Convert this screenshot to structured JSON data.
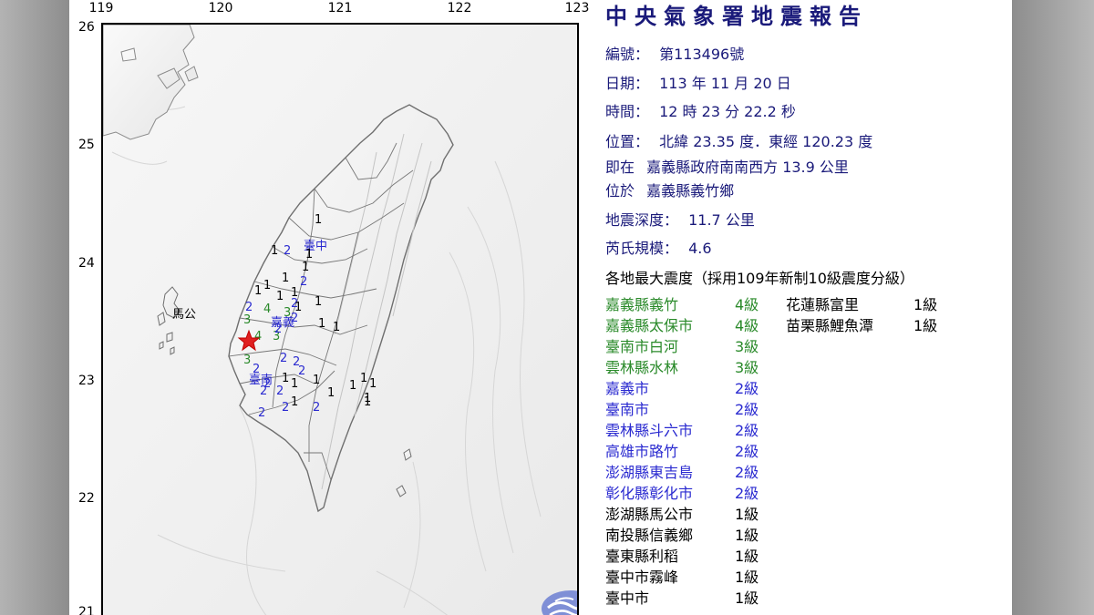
{
  "report": {
    "title": "中央氣象署地震報告",
    "number_label": "編號：",
    "number_value": "第113496號",
    "date_label": "日期：",
    "date_value": "113 年 11 月 20 日",
    "time_label": "時間：",
    "time_value": "12 時 23 分 22.2 秒",
    "location_label": "位置：",
    "location_value": "北緯 23.35 度．東經 120.23 度",
    "near_label": "即在",
    "near_value": "嘉義縣政府南南西方 13.9 公里",
    "region_label": "位於",
    "region_value": "嘉義縣義竹鄉",
    "depth_label": "地震深度：",
    "depth_value": "11.7 公里",
    "magnitude_label": "芮氏規模：",
    "magnitude_value": "4.6",
    "intensity_heading": "各地最大震度（採用109年新制10級震度分級）"
  },
  "intensity_left": [
    {
      "place": "嘉義縣義竹",
      "level": "4級",
      "color": "#2a8a2a"
    },
    {
      "place": "嘉義縣太保市",
      "level": "4級",
      "color": "#2a8a2a"
    },
    {
      "place": "臺南市白河",
      "level": "3級",
      "color": "#2a8a2a"
    },
    {
      "place": "雲林縣水林",
      "level": "3級",
      "color": "#2a8a2a"
    },
    {
      "place": "嘉義市",
      "level": "2級",
      "color": "#2a2ad0"
    },
    {
      "place": "臺南市",
      "level": "2級",
      "color": "#2a2ad0"
    },
    {
      "place": "雲林縣斗六市",
      "level": "2級",
      "color": "#2a2ad0"
    },
    {
      "place": "高雄市路竹",
      "level": "2級",
      "color": "#2a2ad0"
    },
    {
      "place": "澎湖縣東吉島",
      "level": "2級",
      "color": "#2a2ad0"
    },
    {
      "place": "彰化縣彰化市",
      "level": "2級",
      "color": "#2a2ad0"
    },
    {
      "place": "澎湖縣馬公市",
      "level": "1級",
      "color": "#000000"
    },
    {
      "place": "南投縣信義鄉",
      "level": "1級",
      "color": "#000000"
    },
    {
      "place": "臺東縣利稻",
      "level": "1級",
      "color": "#000000"
    },
    {
      "place": "臺中市霧峰",
      "level": "1級",
      "color": "#000000"
    },
    {
      "place": "臺中市",
      "level": "1級",
      "color": "#000000"
    }
  ],
  "intensity_right": [
    {
      "place": "花蓮縣富里",
      "level": "1級",
      "color": "#000000"
    },
    {
      "place": "苗栗縣鯉魚潭",
      "level": "1級",
      "color": "#000000"
    }
  ],
  "map": {
    "lon_ticks": [
      "119",
      "120",
      "121",
      "122",
      "123"
    ],
    "lat_ticks": [
      "26",
      "25",
      "24",
      "23",
      "22",
      "21"
    ],
    "city_labels": [
      {
        "text": "臺中",
        "id": "taichung"
      },
      {
        "text": "嘉義",
        "id": "chiayi"
      },
      {
        "text": "臺南",
        "id": "tainan"
      },
      {
        "text": "馬公",
        "id": "magong"
      }
    ],
    "station_marks": [
      {
        "v": "1",
        "c": "#000000"
      },
      {
        "v": "1",
        "c": "#000000"
      },
      {
        "v": "2",
        "c": "#2a2ad0"
      },
      {
        "v": "1",
        "c": "#000000"
      },
      {
        "v": "1",
        "c": "#000000"
      },
      {
        "v": "1",
        "c": "#000000"
      },
      {
        "v": "1",
        "c": "#000000"
      },
      {
        "v": "1",
        "c": "#000000"
      },
      {
        "v": "1",
        "c": "#000000"
      },
      {
        "v": "1",
        "c": "#000000"
      },
      {
        "v": "2",
        "c": "#2a2ad0"
      },
      {
        "v": "2",
        "c": "#2a2ad0"
      },
      {
        "v": "1",
        "c": "#000000"
      },
      {
        "v": "1",
        "c": "#000000"
      },
      {
        "v": "3",
        "c": "#2a8a2a"
      },
      {
        "v": "2",
        "c": "#2a2ad0"
      },
      {
        "v": "4",
        "c": "#2a8a2a"
      },
      {
        "v": "3",
        "c": "#2a8a2a"
      },
      {
        "v": "2",
        "c": "#2a2ad0"
      },
      {
        "v": "1",
        "c": "#000000"
      },
      {
        "v": "1",
        "c": "#000000"
      },
      {
        "v": "4",
        "c": "#2a8a2a"
      },
      {
        "v": "3",
        "c": "#2a8a2a"
      },
      {
        "v": "2",
        "c": "#2a2ad0"
      },
      {
        "v": "3",
        "c": "#2a8a2a"
      },
      {
        "v": "2",
        "c": "#2a2ad0"
      },
      {
        "v": "2",
        "c": "#2a2ad0"
      },
      {
        "v": "2",
        "c": "#2a2ad0"
      },
      {
        "v": "1",
        "c": "#000000"
      },
      {
        "v": "2",
        "c": "#2a2ad0"
      },
      {
        "v": "1",
        "c": "#000000"
      },
      {
        "v": "1",
        "c": "#000000"
      },
      {
        "v": "1",
        "c": "#000000"
      },
      {
        "v": "2",
        "c": "#2a2ad0"
      },
      {
        "v": "2",
        "c": "#2a2ad0"
      },
      {
        "v": "2",
        "c": "#2a2ad0"
      },
      {
        "v": "1",
        "c": "#000000"
      },
      {
        "v": "2",
        "c": "#2a2ad0"
      },
      {
        "v": "2",
        "c": "#2a2ad0"
      },
      {
        "v": "1",
        "c": "#000000"
      },
      {
        "v": "1",
        "c": "#000000"
      },
      {
        "v": "1",
        "c": "#000000"
      },
      {
        "v": "1",
        "c": "#000000"
      },
      {
        "v": "1",
        "c": "#000000"
      },
      {
        "v": "2",
        "c": "#2a2ad0"
      }
    ],
    "epicenter_color": "#e02020"
  }
}
